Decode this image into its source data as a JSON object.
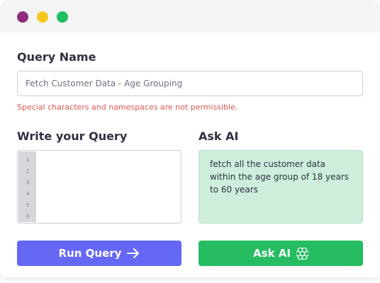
{
  "window": {
    "controls": [
      "close",
      "minimize",
      "maximize"
    ]
  },
  "query_name": {
    "label": "Query Name",
    "value": "Fetch Customer Data - Age Grouping",
    "error": "Special characters and namespaces are not permissible."
  },
  "editor": {
    "label": "Write your Query",
    "line_numbers": [
      "1",
      "2",
      "3",
      "4",
      "5",
      "6"
    ],
    "content": ""
  },
  "ask_ai": {
    "label": "Ask AI",
    "prompt": "fetch all the customer data within the age group of 18 years to 60 years"
  },
  "buttons": {
    "run_label": "Run Query",
    "ask_label": "Ask AI"
  },
  "colors": {
    "run_button": "#6568f5",
    "ask_button": "#26bd62",
    "ai_box": "#cdeedb",
    "error": "#e0574f"
  },
  "icons": {
    "run": "arrow-right-icon",
    "ask": "openai-logo-icon"
  }
}
